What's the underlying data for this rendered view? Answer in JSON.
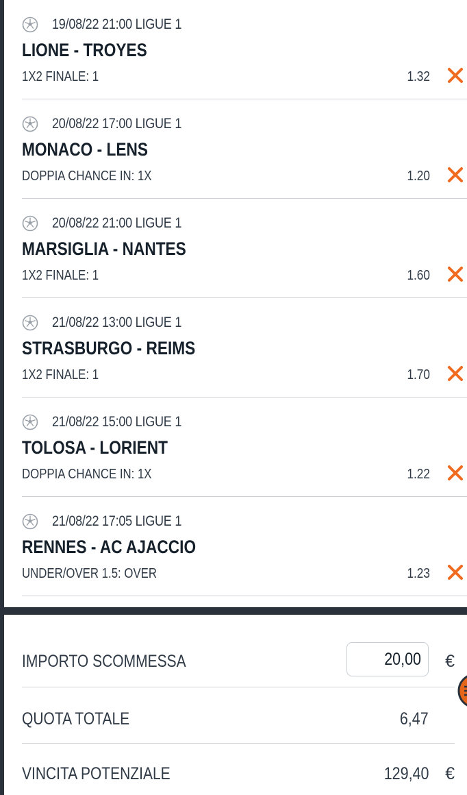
{
  "events": [
    {
      "date": "19/08/22 21:00 LIGUE 1",
      "match": "LIONE - TROYES",
      "market": "1X2 FINALE: 1",
      "odd": "1.32"
    },
    {
      "date": "20/08/22 17:00 LIGUE 1",
      "match": "MONACO - LENS",
      "market": "DOPPIA CHANCE IN: 1X",
      "odd": "1.20"
    },
    {
      "date": "20/08/22 21:00 LIGUE 1",
      "match": "MARSIGLIA - NANTES",
      "market": "1X2 FINALE: 1",
      "odd": "1.60"
    },
    {
      "date": "21/08/22 13:00 LIGUE 1",
      "match": "STRASBURGO - REIMS",
      "market": "1X2 FINALE: 1",
      "odd": "1.70"
    },
    {
      "date": "21/08/22 15:00 LIGUE 1",
      "match": "TOLOSA - LORIENT",
      "market": "DOPPIA CHANCE IN: 1X",
      "odd": "1.22"
    },
    {
      "date": "21/08/22 17:05 LIGUE 1",
      "match": "RENNES - AC AJACCIO",
      "market": "UNDER/OVER 1.5: OVER",
      "odd": "1.23"
    }
  ],
  "icons": {
    "sport": "soccer-ball-icon",
    "remove": "close-icon"
  },
  "colors": {
    "accent": "#f06a1f",
    "dark": "#2b313a",
    "text": "#2f3a46",
    "divider": "#cfd3d8"
  },
  "summary": {
    "stake_label": "IMPORTO SCOMMESSA",
    "stake_value": "20,00",
    "currency": "€",
    "total_odds_label": "QUOTA TOTALE",
    "total_odds_value": "6,47",
    "potential_win_label": "VINCITA POTENZIALE",
    "potential_win_value": "129,40"
  }
}
